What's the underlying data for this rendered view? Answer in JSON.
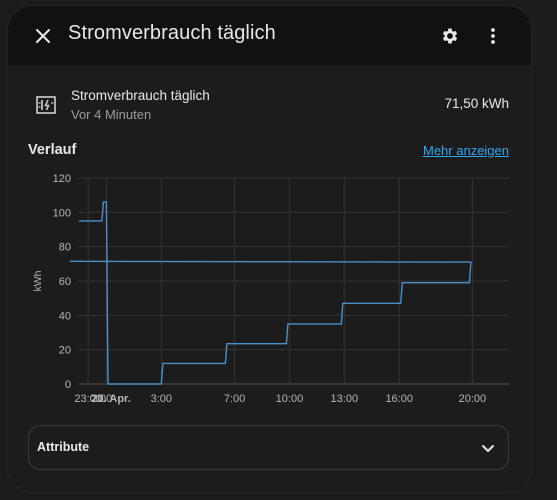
{
  "dialog": {
    "title": "Stromverbrauch täglich",
    "close_icon": "close-icon",
    "settings_icon": "gear-icon",
    "more_icon": "more-vert-icon"
  },
  "entity": {
    "icon": "meter-icon",
    "name": "Stromverbrauch täglich",
    "last_changed": "Vor 4 Minuten",
    "value": "71,50 kWh"
  },
  "history": {
    "title": "Verlauf",
    "more_link": "Mehr anzeigen"
  },
  "chart_data": {
    "type": "line",
    "ylabel": "kWh",
    "ylim": [
      0,
      120
    ],
    "yticks": [
      0,
      20,
      40,
      60,
      80,
      100,
      120
    ],
    "x_tick_labels": [
      "23:00",
      "2:00",
      "20. Apr.",
      "3:00",
      "7:00",
      "10:00",
      "13:00",
      "16:00",
      "20:00"
    ],
    "grid": true,
    "color": "#4a90c9",
    "series": [
      {
        "name": "",
        "points": [
          {
            "t": "22:30",
            "y": 95
          },
          {
            "t": "23:45",
            "y": 95
          },
          {
            "t": "23:50",
            "y": 106
          },
          {
            "t": "00:00",
            "y": 106
          },
          {
            "t": "00:05",
            "y": 0
          },
          {
            "t": "03:00",
            "y": 0
          },
          {
            "t": "03:05",
            "y": 12
          },
          {
            "t": "06:30",
            "y": 12
          },
          {
            "t": "06:35",
            "y": 23.5
          },
          {
            "t": "09:50",
            "y": 23.5
          },
          {
            "t": "09:55",
            "y": 35
          },
          {
            "t": "12:50",
            "y": 35
          },
          {
            "t": "12:55",
            "y": 47
          },
          {
            "t": "16:05",
            "y": 47
          },
          {
            "t": "16:10",
            "y": 59
          },
          {
            "t": "19:50",
            "y": 59
          },
          {
            "t": "19:55",
            "y": 71
          },
          {
            "t": "22:00",
            "y": 71.5
          }
        ]
      }
    ]
  },
  "attributes": {
    "label": "Attribute",
    "chevron_icon": "chevron-down-icon"
  }
}
